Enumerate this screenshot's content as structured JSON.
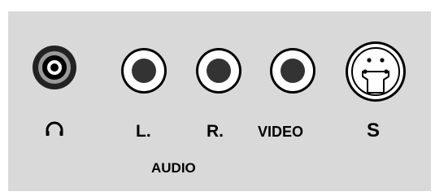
{
  "panel": {
    "background": "#d9d9d9",
    "jacks": [
      {
        "id": "headphone",
        "kind": "stereo-mini-jack",
        "label_icon": "headphones-icon"
      },
      {
        "id": "audio-left",
        "kind": "rca-jack",
        "label": "L."
      },
      {
        "id": "audio-right",
        "kind": "rca-jack",
        "label": "R."
      },
      {
        "id": "video",
        "kind": "rca-jack",
        "label": "VIDEO"
      },
      {
        "id": "s-video",
        "kind": "s-video-jack",
        "label": "S"
      }
    ],
    "group_label": "AUDIO",
    "colors": {
      "jack_ring": "#000000",
      "jack_face": "#ffffff",
      "jack_hole": "#333333",
      "headphone_ring": "#555555"
    }
  }
}
